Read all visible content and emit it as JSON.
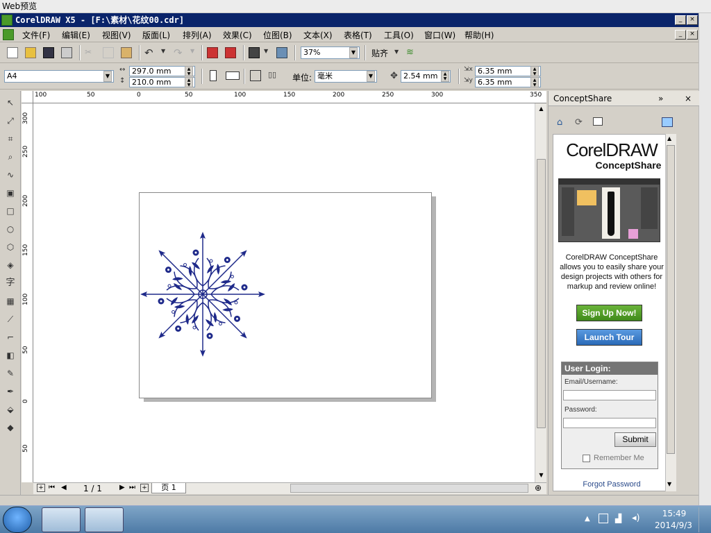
{
  "outer_window": {
    "title": "Web预览"
  },
  "app": {
    "title": "CorelDRAW X5 - [F:\\素材\\花纹00.cdr]"
  },
  "menu": {
    "items": [
      "文件(F)",
      "编辑(E)",
      "视图(V)",
      "版面(L)",
      "排列(A)",
      "效果(C)",
      "位图(B)",
      "文本(X)",
      "表格(T)",
      "工具(O)",
      "窗口(W)",
      "帮助(H)"
    ]
  },
  "toolbar": {
    "zoom": "37%",
    "snap_label": "贴齐"
  },
  "propbar": {
    "paper": "A4",
    "width": "297.0 mm",
    "height": "210.0 mm",
    "units_label": "单位:",
    "units_value": "毫米",
    "nudge": "2.54 mm",
    "dup_x": "6.35 mm",
    "dup_y": "6.35 mm"
  },
  "rulers": {
    "top": [
      "100",
      "50",
      "0",
      "50",
      "100",
      "150",
      "200",
      "250",
      "300",
      "350"
    ],
    "left": [
      "300",
      "250",
      "200",
      "150",
      "100",
      "50",
      "0",
      "50"
    ]
  },
  "pager": {
    "count": "1 / 1",
    "tab": "页 1"
  },
  "docker": {
    "title": "ConceptShare",
    "logo_main": "CorelDRAW",
    "logo_sub": "ConceptShare",
    "desc": "CorelDRAW ConceptShare allows you to easily share your design projects with others for markup and review online!",
    "signup_label": "Sign Up Now!",
    "tour_label": "Launch Tour",
    "login_title": "User Login:",
    "email_label": "Email/Username:",
    "password_label": "Password:",
    "submit_label": "Submit",
    "remember_label": "Remember Me",
    "forgot_label": "Forgot Password"
  },
  "taskbar": {
    "time": "15:49",
    "date": "2014/9/3"
  },
  "colors": {
    "title_bar": "#0a246a",
    "ornament": "#1f2a8a",
    "signup_green": "#4a9a1e",
    "tour_blue": "#2f78c4"
  }
}
